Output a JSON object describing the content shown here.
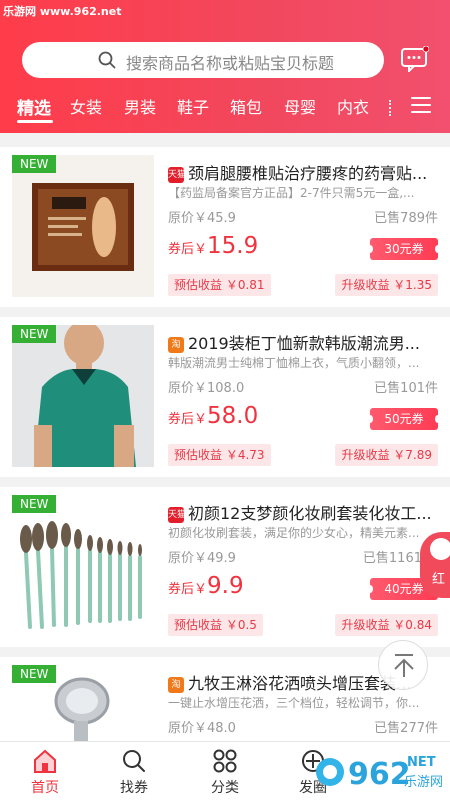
{
  "watermark": "乐游网 www.962.net",
  "search": {
    "placeholder": "搜索商品名称或粘贴宝贝标题"
  },
  "tabs": [
    "精选",
    "女装",
    "男装",
    "鞋子",
    "箱包",
    "母婴",
    "内衣"
  ],
  "products": [
    {
      "shop": "天猫",
      "title": "颈肩腿腰椎贴治疗腰疼的药膏贴...",
      "desc": "【药监局备案官方正品】2-7件只需5元一盒,...",
      "orig": "原价￥45.9",
      "sold": "已售789件",
      "coupon_label": "券后￥",
      "coupon_price": "15.9",
      "coupon": "30元券",
      "est": "预估收益 ￥0.81",
      "up": "升级收益 ￥1.35",
      "new": "NEW"
    },
    {
      "shop": "淘",
      "title": "2019装柜丁恤新款韩版潮流男...",
      "desc": "韩版潮流男士纯棉丁恤棉上衣，气质小翻领，...",
      "orig": "原价￥108.0",
      "sold": "已售101件",
      "coupon_label": "券后￥",
      "coupon_price": "58.0",
      "coupon": "50元券",
      "est": "预估收益 ￥4.73",
      "up": "升级收益 ￥7.89",
      "new": "NEW"
    },
    {
      "shop": "天猫",
      "title": "初颜12支梦颜化妆刷套装化妆工...",
      "desc": "初颜化妆刷套装，满足你的少女心，精美元素...",
      "orig": "原价￥49.9",
      "sold": "已售1161",
      "coupon_label": "券后￥",
      "coupon_price": "9.9",
      "coupon": "40元券",
      "est": "预估收益 ￥0.5",
      "up": "升级收益 ￥0.84",
      "new": "NEW"
    },
    {
      "shop": "淘",
      "title": "九牧王淋浴花洒喷头增压套装...",
      "desc": "一键止水增压花洒，三个档位，轻松调节，你...",
      "orig": "原价￥48.0",
      "sold": "已售277件",
      "new": "NEW"
    }
  ],
  "float_red": "红",
  "nav": [
    {
      "label": "首页",
      "icon": "home-icon",
      "badge": "首页"
    },
    {
      "label": "找券",
      "icon": "search-icon"
    },
    {
      "label": "分类",
      "icon": "category-icon"
    },
    {
      "label": "发圈",
      "icon": "share-icon"
    }
  ],
  "logo": {
    "main": "962",
    "suffix": ".NET",
    "sub": "乐游网"
  },
  "colors": {
    "brand": "#f0333e",
    "header": "#f2485e",
    "new_tag": "#35b034"
  }
}
